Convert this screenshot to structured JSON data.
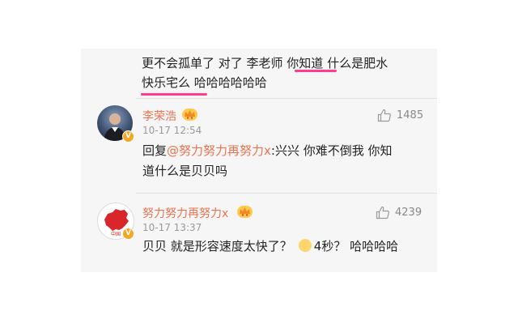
{
  "prev_comment": {
    "line1": "更不会孤单了 对了 李老师 你知道 什么是肥水",
    "line2": "快乐宅么 哈哈哈哈哈哈"
  },
  "comments": [
    {
      "username": "李荣浩",
      "timestamp": "10-17 12:54",
      "likes": "1485",
      "reply_prefix": "回复",
      "mention": "@努力努力再努力x",
      "line1_rest": ":兴兴 你难不倒我 你知",
      "line2": "道什么是贝贝吗"
    },
    {
      "username": "努力努力再努力x",
      "timestamp": "10-17 13:37",
      "likes": "4239",
      "text_before_emoji": "贝贝 就是形容速度太快了？",
      "text_after_emoji": "4秒？ 哈哈哈哈"
    }
  ],
  "colors": {
    "username": "#eb7350",
    "underline": "#ff3c8e",
    "meta": "#999999"
  },
  "icons": [
    "thumbs-up-icon",
    "verified-badge-icon",
    "crown-emoji-icon",
    "awkward-face-emoji"
  ]
}
